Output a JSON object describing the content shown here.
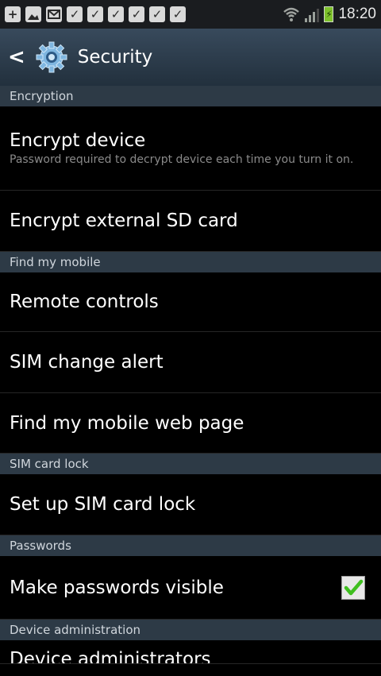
{
  "status_bar": {
    "time": "18:20",
    "notification_icons": [
      "plus-icon",
      "image-icon",
      "mail-icon",
      "check-icon",
      "check-icon",
      "check-icon",
      "check-icon",
      "check-icon",
      "check-icon"
    ]
  },
  "action_bar": {
    "title": "Security"
  },
  "sections": {
    "encryption": "Encryption",
    "find_my_mobile": "Find my mobile",
    "sim_card_lock": "SIM card lock",
    "passwords": "Passwords",
    "device_administration": "Device administration"
  },
  "items": {
    "encrypt_device": {
      "label": "Encrypt device",
      "summary": "Password required to decrypt device each time you turn it on."
    },
    "encrypt_sd": {
      "label": "Encrypt external SD card"
    },
    "remote_controls": {
      "label": "Remote controls"
    },
    "sim_change_alert": {
      "label": "SIM change alert"
    },
    "find_web_page": {
      "label": "Find my mobile web page"
    },
    "sim_lock": {
      "label": "Set up SIM card lock"
    },
    "passwords_visible": {
      "label": "Make passwords visible",
      "checked": true
    },
    "device_admins": {
      "label": "Device administrators"
    }
  },
  "colors": {
    "accent_check": "#3fbf1f",
    "section_bg": "#2d3a46",
    "background": "#000000"
  }
}
